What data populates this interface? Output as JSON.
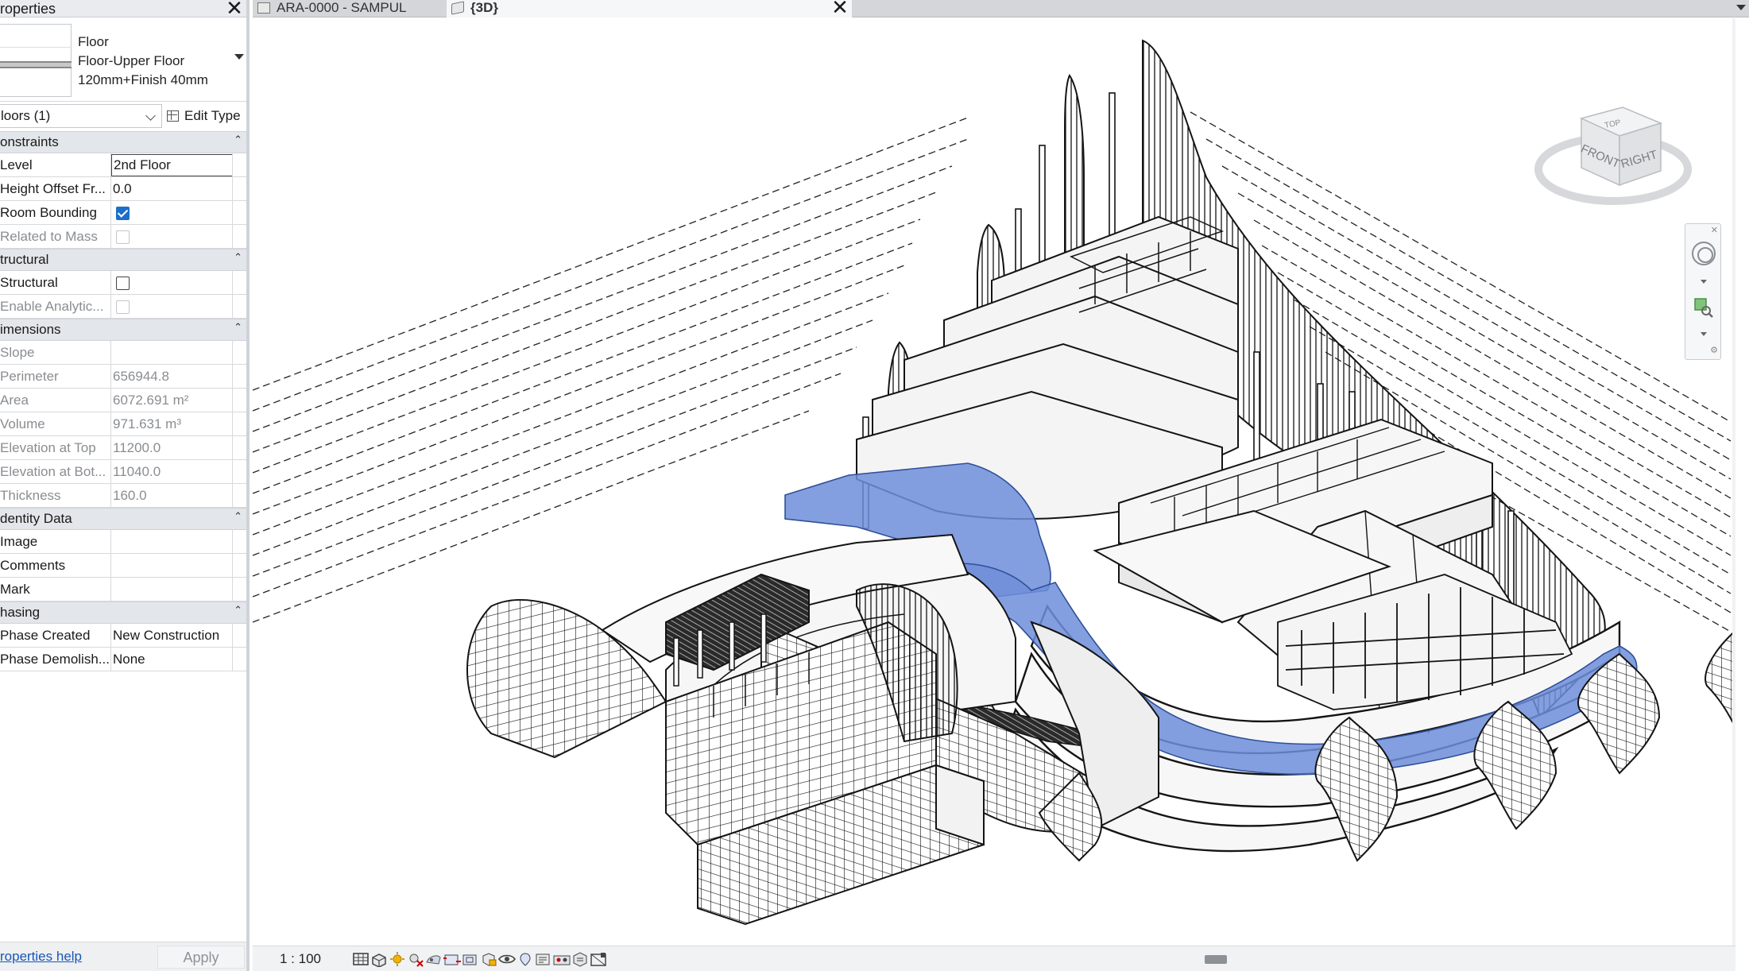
{
  "properties": {
    "title": "roperties",
    "close_glyph": "✕",
    "type_family": "Floor",
    "type_name": "Floor-Upper Floor",
    "type_desc": "120mm+Finish 40mm",
    "instance_filter": "loors (1)",
    "edit_type_label": "Edit Type",
    "categories": [
      {
        "name": "onstraints",
        "rows": [
          {
            "name": "Level",
            "value": "2nd Floor",
            "kind": "edit"
          },
          {
            "name": "Height Offset Fr...",
            "value": "0.0",
            "kind": "text"
          },
          {
            "name": "Room Bounding",
            "value": "",
            "kind": "checkbox",
            "checked": true
          },
          {
            "name": "Related to Mass",
            "value": "",
            "kind": "checkbox",
            "checked": false,
            "disabled": true
          }
        ]
      },
      {
        "name": "tructural",
        "rows": [
          {
            "name": "Structural",
            "value": "",
            "kind": "checkbox",
            "checked": false
          },
          {
            "name": "Enable Analytic...",
            "value": "",
            "kind": "checkbox",
            "checked": false,
            "disabled": true
          }
        ]
      },
      {
        "name": "imensions",
        "rows": [
          {
            "name": "Slope",
            "value": "",
            "kind": "text",
            "disabled": true
          },
          {
            "name": "Perimeter",
            "value": "656944.8",
            "kind": "text",
            "disabled": true
          },
          {
            "name": "Area",
            "value": "6072.691 m²",
            "kind": "text",
            "disabled": true
          },
          {
            "name": "Volume",
            "value": "971.631 m³",
            "kind": "text",
            "disabled": true
          },
          {
            "name": "Elevation at Top",
            "value": "11200.0",
            "kind": "text",
            "disabled": true
          },
          {
            "name": "Elevation at Bot...",
            "value": "11040.0",
            "kind": "text",
            "disabled": true
          },
          {
            "name": "Thickness",
            "value": "160.0",
            "kind": "text",
            "disabled": true
          }
        ]
      },
      {
        "name": "dentity Data",
        "rows": [
          {
            "name": "Image",
            "value": "",
            "kind": "text"
          },
          {
            "name": "Comments",
            "value": "",
            "kind": "text"
          },
          {
            "name": "Mark",
            "value": "",
            "kind": "text"
          }
        ]
      },
      {
        "name": "hasing",
        "rows": [
          {
            "name": "Phase Created",
            "value": "New Construction",
            "kind": "text"
          },
          {
            "name": "Phase Demolish...",
            "value": "None",
            "kind": "text"
          }
        ]
      }
    ],
    "help_link": "roperties help",
    "apply_label": "Apply"
  },
  "tabs": [
    {
      "label": "ARA-0000 - SAMPUL",
      "active": false,
      "icon": "sheet-icon"
    },
    {
      "label": "{3D}",
      "active": true,
      "icon": "3d-view-icon"
    }
  ],
  "tab_close_glyph": "✕",
  "viewcube": {
    "top": "TOP",
    "front": "FRONT",
    "right": "RIGHT"
  },
  "viewbar": {
    "scale": "1 : 100",
    "icons": [
      "detail-level-icon",
      "visual-style-icon",
      "sun-path-icon",
      "shadows-icon",
      "render-icon",
      "crop-view-icon",
      "show-crop-icon",
      "unlock-3d-icon",
      "temporary-hide-icon",
      "reveal-hidden-icon",
      "temporary-properties-icon",
      "worksharing-icon",
      "design-options-icon",
      "analytical-model-icon"
    ]
  },
  "colors": {
    "selection_blue": "#6f8ed9",
    "line": "#141414",
    "link": "#1a56b8",
    "checkbox_blue": "#1c6fc9"
  }
}
